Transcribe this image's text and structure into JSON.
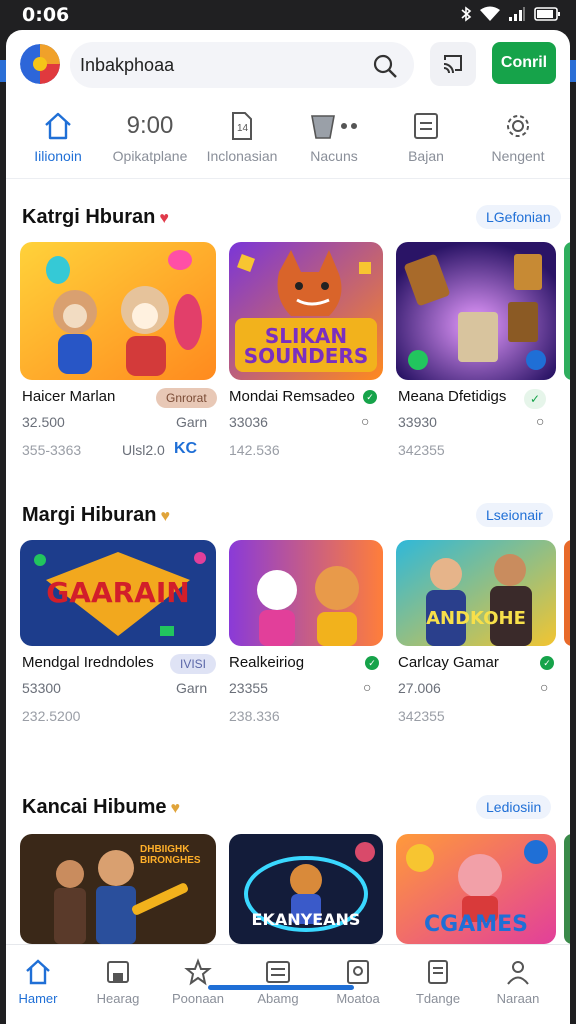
{
  "status": {
    "time": "0:06"
  },
  "header": {
    "search_text": "Inbakphoaa",
    "cta_label": "Conril"
  },
  "categories": [
    {
      "label": "Iilionoin",
      "icon": "home-icon"
    },
    {
      "label": "Opikatplane",
      "icon": "clock-9-icon",
      "glyph": "9:00"
    },
    {
      "label": "Inclonasian",
      "icon": "document-icon"
    },
    {
      "label": "Nacuns",
      "icon": "bucket-icon"
    },
    {
      "label": "Bajan",
      "icon": "list-icon"
    },
    {
      "label": "Nengent",
      "icon": "gear-icon"
    }
  ],
  "sections": [
    {
      "title": "Katrgi Hburan",
      "heart": "♥",
      "heart_color": "#e03a4a",
      "pill": "LGefonian",
      "cards": [
        {
          "title": "Haicer Marlan",
          "tag": "Gnrorat",
          "tag_color": "#e8c8b6",
          "tag_text_color": "#7a4b35",
          "line2": "32.500",
          "line2_right": "Garn",
          "line3": "355-3363",
          "line3_right": "Ulsl2.0",
          "line3_badge": "KC",
          "art": "bears"
        },
        {
          "title": "Mondai Remsadeo",
          "line2": "33036",
          "line3": "142.536",
          "art": "fox",
          "art_text": "SLIKAN SOUNDERS"
        },
        {
          "title": "Meana Dfetidigs",
          "line2": "33930",
          "line3": "342355",
          "art": "cards"
        }
      ]
    },
    {
      "title": "Margi Hiburan",
      "heart": "♥",
      "heart_color": "#e0a43a",
      "pill": "Lseionair",
      "cards": [
        {
          "title": "Mendgal Iredndoles",
          "tag": "IVISI",
          "tag_color": "#dfe3f5",
          "tag_text_color": "#5a66a8",
          "line2": "53300",
          "line2_right": "Garn",
          "line3": "232.5200",
          "art": "garain",
          "art_text": "GAARAIN"
        },
        {
          "title": "Realkeiriog",
          "line2": "23355",
          "line3": "238.336",
          "art": "cartoon"
        },
        {
          "title": "Carlcay Gamar",
          "line2": "27.006",
          "line3": "342355",
          "art": "people",
          "art_text": "ANDKOHE"
        }
      ]
    },
    {
      "title": "Kancai Hibume",
      "heart": "♥",
      "heart_color": "#e0a43a",
      "pill": "Lediosiin",
      "cards": [
        {
          "title": "",
          "art": "men",
          "art_text": "DHBIIGHK BIRONGHES"
        },
        {
          "title": "",
          "art": "bear2",
          "art_text": "EKANYEANS"
        },
        {
          "title": "",
          "art": "cgames",
          "art_text": "CGAMES"
        }
      ]
    }
  ],
  "bottom_nav": [
    {
      "label": "Hamer",
      "icon": "home-icon"
    },
    {
      "label": "Hearag",
      "icon": "save-icon"
    },
    {
      "label": "Poonaan",
      "icon": "star-icon"
    },
    {
      "label": "Abamg",
      "icon": "newspaper-icon"
    },
    {
      "label": "Moatoa",
      "icon": "doc-frame-icon"
    },
    {
      "label": "Tdange",
      "icon": "list-doc-icon"
    },
    {
      "label": "Naraan",
      "icon": "person-icon"
    }
  ],
  "colors": {
    "accent": "#1f6fd6",
    "cta": "#16a34a"
  }
}
